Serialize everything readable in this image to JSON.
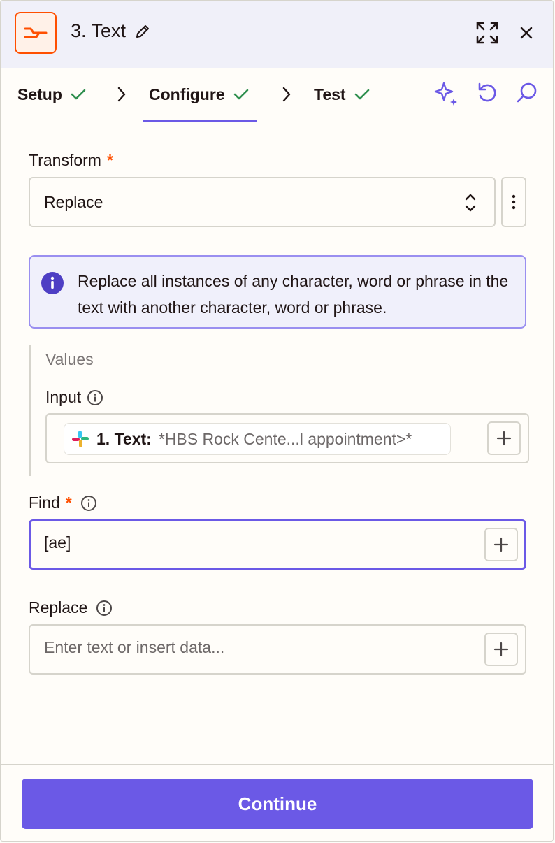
{
  "header": {
    "title": "3. Text",
    "app_icon": "text-formatter-icon",
    "accent_color": "#ff4f00"
  },
  "tabs": [
    {
      "label": "Setup",
      "complete": true
    },
    {
      "label": "Configure",
      "complete": true,
      "active": true
    },
    {
      "label": "Test",
      "complete": true
    }
  ],
  "toolbar_icons": [
    "sparkle-icon",
    "undo-icon",
    "search-icon"
  ],
  "form": {
    "transform": {
      "label": "Transform",
      "required_mark": "*",
      "value": "Replace"
    },
    "info": {
      "text": "Replace all instances of any character, word or phrase in the text with another character, word or phrase."
    },
    "values": {
      "title": "Values",
      "input": {
        "label": "Input",
        "pill_name": "1. Text:",
        "pill_value": "*HBS Rock Cente...l appointment>*"
      }
    },
    "find": {
      "label": "Find",
      "required_mark": "*",
      "value": "[ae]"
    },
    "replace": {
      "label": "Replace",
      "placeholder": "Enter text or insert data..."
    }
  },
  "footer": {
    "continue_label": "Continue"
  },
  "colors": {
    "primary": "#6b59e6",
    "success": "#2f8f4e"
  }
}
